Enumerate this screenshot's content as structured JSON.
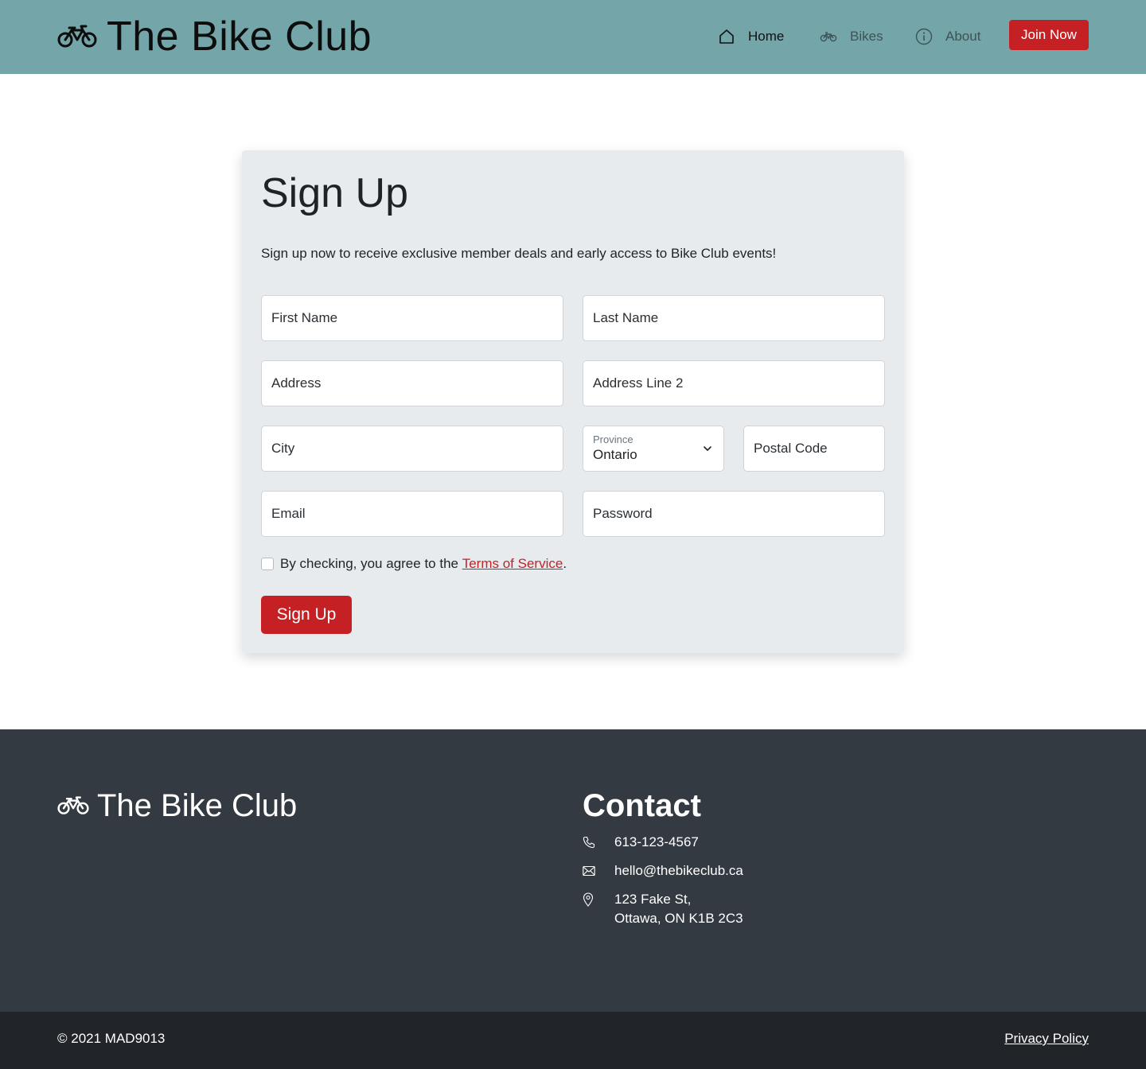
{
  "header": {
    "brand": "The Bike Club",
    "nav": [
      {
        "label": "Home",
        "icon": "house-icon"
      },
      {
        "label": "Bikes",
        "icon": "bicycle-icon"
      },
      {
        "label": "About",
        "icon": "info-circle-icon"
      }
    ],
    "cta": "Join Now"
  },
  "form": {
    "title": "Sign Up",
    "lead": "Sign up now to receive exclusive member deals and early access to Bike Club events!",
    "first_name": "First Name",
    "last_name": "Last Name",
    "address": "Address",
    "address2": "Address Line 2",
    "city": "City",
    "province_label": "Province",
    "province_value": "Ontario",
    "postal": "Postal Code",
    "email": "Email",
    "password": "Password",
    "terms_prefix": "By checking, you agree to the",
    "terms_link": "Terms of Service",
    "terms_suffix": ".",
    "submit": "Sign Up"
  },
  "footer": {
    "brand": "The Bike Club",
    "contact_title": "Contact",
    "phone": "613-123-4567",
    "email": "hello@thebikeclub.ca",
    "address_line1": "123 Fake St,",
    "address_line2": "Ottawa, ON K1B 2C3",
    "copyright": "© 2021 MAD9013",
    "privacy": "Privacy Policy"
  },
  "colors": {
    "navbar": "#73a5a9",
    "accent": "#c52124",
    "card": "#e7ebee",
    "footer": "#343a41",
    "bottom_bar": "#212428"
  }
}
